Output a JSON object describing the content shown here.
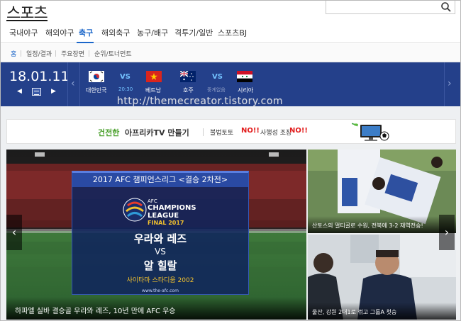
{
  "header": {
    "logo": "스포츠",
    "search_placeholder": ""
  },
  "mainnav": [
    {
      "label": "국내야구"
    },
    {
      "label": "해외야구"
    },
    {
      "label": "축구",
      "active": true
    },
    {
      "label": "해외축구"
    },
    {
      "label": "농구/배구"
    },
    {
      "label": "격투기/일반"
    },
    {
      "label": "스포츠BJ"
    }
  ],
  "subnav": [
    {
      "label": "홈",
      "active": true
    },
    {
      "label": "일정/결과"
    },
    {
      "label": "주요장면"
    },
    {
      "label": "순위/토너먼트"
    }
  ],
  "schedule": {
    "date": "18.01.11",
    "prev": "◀",
    "next": "▶",
    "matches": [
      {
        "home": "대한민국",
        "away": "베트남",
        "vs": "VS",
        "status": "20:30"
      },
      {
        "home": "호주",
        "away": "시리아",
        "vs": "VS",
        "status": "중계없음"
      }
    ]
  },
  "watermark": "http://themecreator.tistory.com",
  "ad": {
    "t1": "건전한",
    "t2": "아프리카TV 만들기",
    "t3": "불법토토",
    "no1": "NO!!",
    "t4": "사행성 조장",
    "no2": "NO!!"
  },
  "main": {
    "card_title": "2017 AFC 챔피언스리그 <결승 2차전>",
    "acl_l1": "AFC",
    "acl_l2": "CHAMPIONS",
    "acl_l3": "LEAGUE",
    "acl_l4": "FINAL 2017",
    "team1": "우라와 레즈",
    "vs": "VS",
    "team2": "알 힐랄",
    "venue": "사이타마 스타디움 2002",
    "site": "www.the-afc.com",
    "caption": "하파엘 실바 결승골 우라와 레즈, 10년 만에 AFC 우승"
  },
  "side": [
    {
      "caption": "산토스의 멀티골로 수원, 전북에 3-2 재역전승!"
    },
    {
      "caption": "울산, 강원 2대1로 꺾고 그룹A 첫승"
    }
  ],
  "colors": {
    "accent": "#1b66c9",
    "schedule_bg": "#24408a"
  }
}
